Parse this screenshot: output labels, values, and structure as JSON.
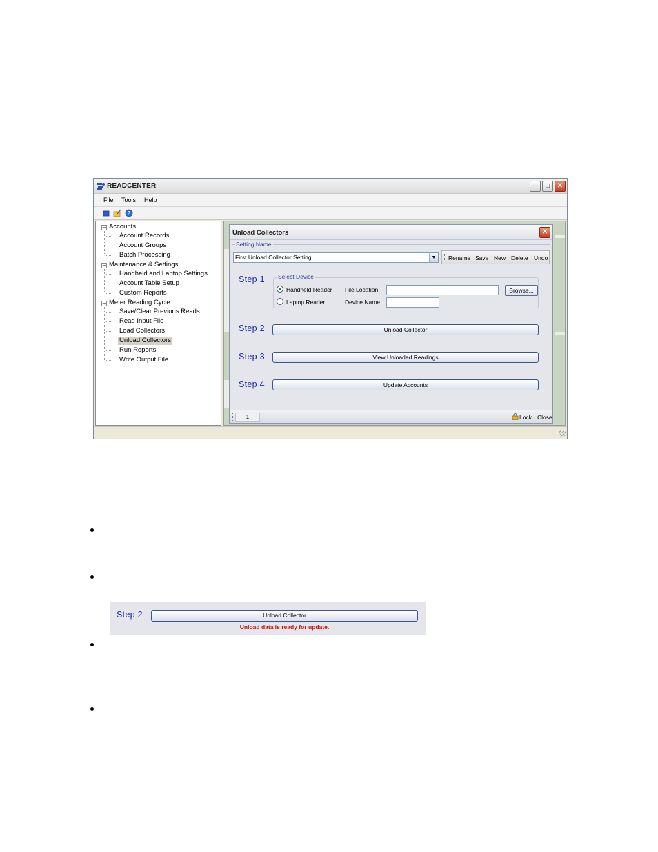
{
  "app": {
    "title": "READCENTER",
    "menu": {
      "file": "File",
      "tools": "Tools",
      "help": "Help"
    },
    "toolbar_icons": [
      "stop-icon",
      "folder-edit-icon",
      "help-icon"
    ]
  },
  "tree": {
    "groups": [
      {
        "label": "Accounts",
        "items": [
          "Account Records",
          "Account Groups",
          "Batch Processing"
        ]
      },
      {
        "label": "Maintenance & Settings",
        "items": [
          "Handheld and Laptop Settings",
          "Account Table Setup",
          "Custom Reports"
        ]
      },
      {
        "label": "Meter Reading Cycle",
        "items": [
          "Save/Clear Previous Reads",
          "Read Input File",
          "Load Collectors",
          "Unload Collectors",
          "Run Reports",
          "Write Output File"
        ]
      }
    ],
    "selected": "Unload Collectors"
  },
  "dialog": {
    "title": "Unload Collectors",
    "setting_name_label": "Setting Name",
    "setting_name_value": "First Unload Collector Setting",
    "setting_actions": {
      "rename": "Rename",
      "save": "Save",
      "new": "New",
      "delete": "Delete",
      "undo": "Undo"
    },
    "step1": {
      "label": "Step 1",
      "group_label": "Select Device",
      "handheld_label": "Handheld Reader",
      "laptop_label": "Laptop Reader",
      "selected_device": "Handheld Reader",
      "file_location_label": "File Location",
      "file_location_value": "",
      "device_name_label": "Device Name",
      "device_name_value": "",
      "browse_label": "Browse..."
    },
    "step2": {
      "label": "Step 2",
      "button": "Unload Collector"
    },
    "step3": {
      "label": "Step 3",
      "button": "View Unloaded Readings"
    },
    "step4": {
      "label": "Step 4",
      "button": "Update Accounts"
    },
    "status": {
      "page": "1",
      "lock": "Lock",
      "close": "Close"
    }
  },
  "snippet": {
    "step_label": "Step 2",
    "button": "Unload Collector",
    "message": "Unload data is ready for update."
  },
  "colors": {
    "step_blue": "#1d2ea8",
    "message_red": "#cc1010",
    "close_red": "#c8401e"
  }
}
